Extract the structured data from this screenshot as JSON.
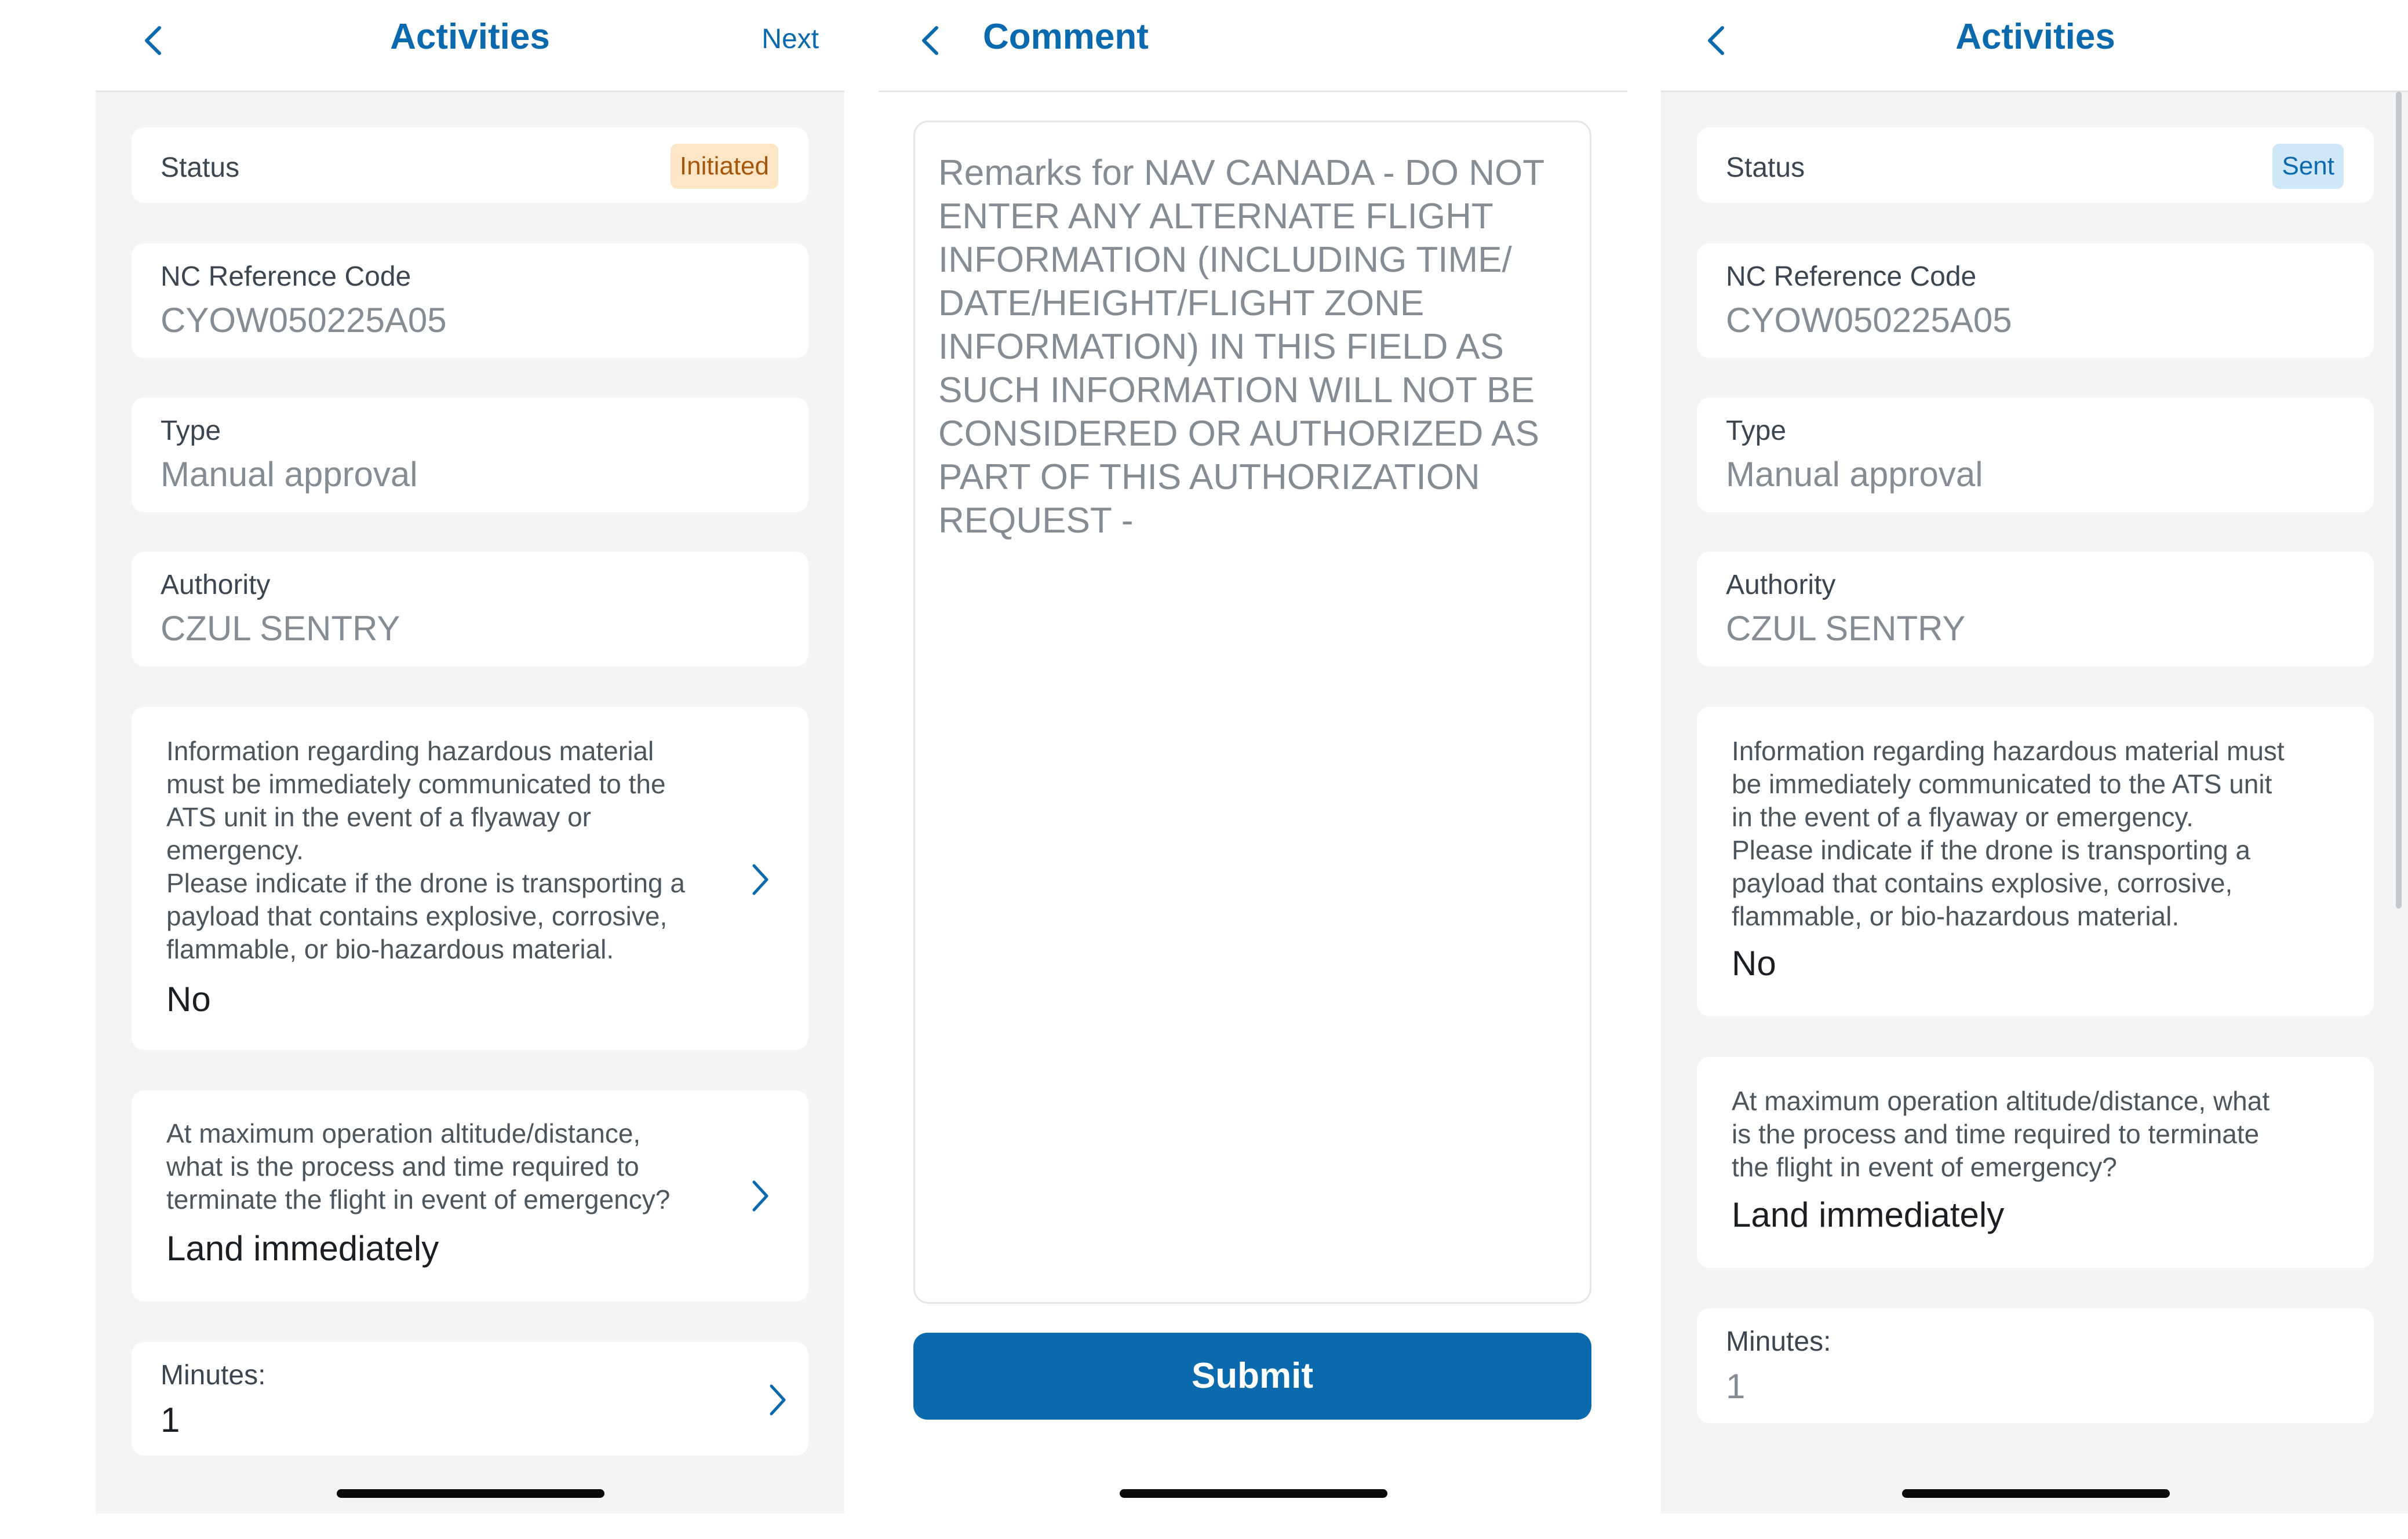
{
  "colors": {
    "brand": "#0b6aad",
    "initiated_bg": "#fde6c6",
    "initiated_text": "#a4560b",
    "sent_bg": "#cfe7f7",
    "sent_text": "#0b6aad"
  },
  "icons": {
    "back": "chevron-left-icon",
    "row": "chevron-right-icon"
  },
  "screen1": {
    "title": "Activities",
    "next_label": "Next",
    "status_label": "Status",
    "status_value": "Initiated",
    "ref_label": "NC Reference Code",
    "ref_value": "CYOW050225A05",
    "type_label": "Type",
    "type_value": "Manual approval",
    "authority_label": "Authority",
    "authority_value": "CZUL SENTRY",
    "hazard_lines": [
      "Information regarding hazardous material",
      "must be immediately communicated to the",
      "ATS unit in the event of a flyaway or",
      "emergency.",
      "Please indicate if the drone is transporting a",
      "payload that contains explosive, corrosive,",
      "flammable, or bio-hazardous material."
    ],
    "hazard_answer": "No",
    "terminate_lines": [
      "At maximum operation altitude/distance,",
      "what is the process and time required to",
      "terminate the flight in event of emergency?"
    ],
    "terminate_answer": "Land immediately",
    "minutes_label": "Minutes:",
    "minutes_value": "1"
  },
  "screen2": {
    "title": "Comment",
    "placeholder_lines": [
      "Remarks for NAV CANADA - DO NOT",
      "ENTER ANY ALTERNATE FLIGHT",
      "INFORMATION (INCLUDING TIME/",
      "DATE/HEIGHT/FLIGHT ZONE",
      "INFORMATION) IN THIS FIELD AS",
      "SUCH INFORMATION WILL NOT BE",
      "CONSIDERED OR AUTHORIZED AS",
      "PART OF THIS AUTHORIZATION",
      "REQUEST -"
    ],
    "submit_label": "Submit"
  },
  "screen3": {
    "title": "Activities",
    "status_label": "Status",
    "status_value": "Sent",
    "ref_label": "NC Reference Code",
    "ref_value": "CYOW050225A05",
    "type_label": "Type",
    "type_value": "Manual approval",
    "authority_label": "Authority",
    "authority_value": "CZUL SENTRY",
    "hazard_lines": [
      "Information regarding hazardous material must",
      "be immediately communicated to the ATS unit",
      "in the event of a flyaway or emergency.",
      "Please indicate if the drone is transporting a",
      "payload that contains explosive, corrosive,",
      "flammable, or bio-hazardous material."
    ],
    "hazard_answer": "No",
    "terminate_lines": [
      "At maximum operation altitude/distance, what",
      "is the process and time required to terminate",
      "the flight in event of emergency?"
    ],
    "terminate_answer": "Land immediately",
    "minutes_label": "Minutes:",
    "minutes_value": "1"
  }
}
